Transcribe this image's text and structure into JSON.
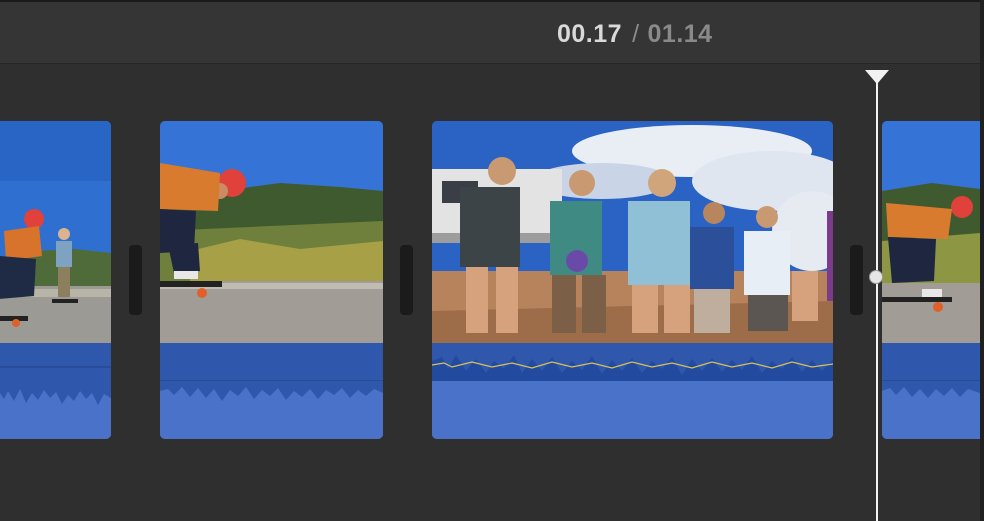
{
  "header": {
    "current_time": "00.17",
    "separator": "/",
    "total_time": "01.14"
  },
  "timeline": {
    "clips": [
      {
        "id": 1,
        "scene": "skateboarder-crouching-on-road"
      },
      {
        "id": 2,
        "scene": "skateboarder-with-red-helmet-riding"
      },
      {
        "id": 3,
        "scene": "group-of-friends-cheering-by-camper"
      },
      {
        "id": 4,
        "scene": "skateboarder-with-red-helmet-riding"
      }
    ],
    "playhead": {
      "position_label": "00.17"
    }
  },
  "colors": {
    "background": "#2f2f2f",
    "audio_track": "#4a72c8",
    "audio_band": "#2f58ad",
    "playhead": "#f2f2f2"
  }
}
